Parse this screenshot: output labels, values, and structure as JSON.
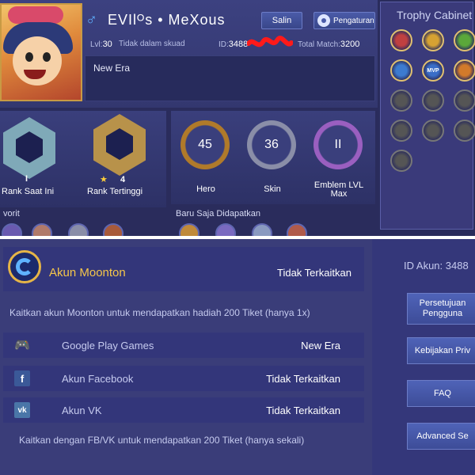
{
  "profile": {
    "name": "EVIlᴼs • MeXous",
    "copy_label": "Salin",
    "settings_label": "Pengaturan",
    "level_label": "Lvl:",
    "level_value": "30",
    "squad_status": "Tidak dalam skuad",
    "id_label": "ID:",
    "id_value": "3488",
    "total_match_label": "Total Match:",
    "total_match_value": "3200",
    "signature": "New Era"
  },
  "trophy_cabinet": {
    "title": "Trophy Cabinet",
    "items": [
      {
        "icon": "red-wing-trophy-icon",
        "color": "#c04040"
      },
      {
        "icon": "gold-cup-trophy-icon",
        "color": "#d6a232"
      },
      {
        "icon": "green-team-trophy-icon",
        "color": "#5ba83a"
      },
      {
        "icon": "blue-sword-trophy-icon",
        "color": "#3c7bd0"
      },
      {
        "icon": "mvp-trophy-icon",
        "color": "#3a6ec8",
        "text": "MVP"
      },
      {
        "icon": "orange-emblem-trophy-icon",
        "color": "#d27a2a"
      },
      {
        "icon": "locked-trophy-icon",
        "color": "#555"
      },
      {
        "icon": "locked-trophy-icon",
        "color": "#555"
      },
      {
        "icon": "locked-trophy-icon",
        "color": "#555"
      },
      {
        "icon": "locked-trophy-icon",
        "color": "#555"
      },
      {
        "icon": "locked-trophy-icon",
        "color": "#555"
      },
      {
        "icon": "locked-trophy-icon",
        "color": "#555"
      },
      {
        "icon": "locked-trophy-icon",
        "color": "#555"
      }
    ]
  },
  "ranks": {
    "current": {
      "tier": "I",
      "label": "Rank Saat Ini",
      "color": "#7fa9b8"
    },
    "highest": {
      "stars": "4",
      "label": "Rank Tertinggi",
      "color": "#b8924a"
    }
  },
  "stats": [
    {
      "value": "45",
      "label": "Hero",
      "color": "#b07a2a"
    },
    {
      "value": "36",
      "label": "Skin",
      "color": "#8a8ea8"
    },
    {
      "value": "II",
      "label": "Emblem LVL Max",
      "color": "#9a5fc0"
    }
  ],
  "sections": {
    "favorite_label": "vorit",
    "recent_label": "Baru Saja Didapatkan"
  },
  "account": {
    "moonton_title": "Akun Moonton",
    "moonton_status": "Tidak Terkaitkan",
    "bind_promo": "Kaitkan akun Moonton untuk mendapatkan hadiah 200 Tiket (hanya 1x)",
    "linked": [
      {
        "name": "Google Play Games",
        "status": "New Era",
        "icon": "gamepad-icon",
        "color": "#5cb83a"
      },
      {
        "name": "Akun Facebook",
        "status": "Tidak Terkaitkan",
        "icon": "facebook-icon",
        "color": "#3b5998"
      },
      {
        "name": "Akun VK",
        "status": "Tidak Terkaitkan",
        "icon": "vk-icon",
        "color": "#4a76a8"
      }
    ],
    "fbvk_promo": "Kaitkan dengan FB/VK untuk mendapatkan 200 Tiket (hanya sekali)",
    "id_label": "ID Akun: 3488"
  },
  "side_buttons": [
    {
      "label": "Persetujuan\nPengguna"
    },
    {
      "label": "Kebijakan Priv"
    },
    {
      "label": "FAQ"
    },
    {
      "label": "Advanced Se"
    }
  ]
}
